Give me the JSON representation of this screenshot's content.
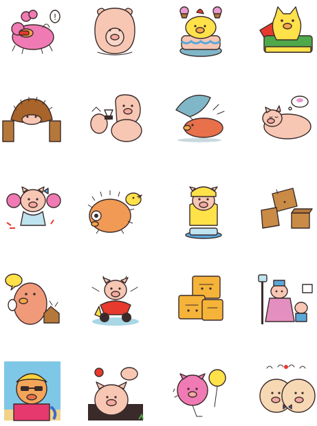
{
  "sheet": {
    "background": "#ffffff",
    "rows": 5,
    "cols": 4
  },
  "palette": {
    "pig_pink": "#f7c7b4",
    "hot_pink": "#f07ab4",
    "yellow": "#ffe14a",
    "brown": "#b5783a",
    "cardboard": "#c98b45",
    "teal": "#7fb7c8",
    "blue": "#5aa7d8",
    "red": "#e63a2e",
    "green": "#4fa84a",
    "orange": "#f5a64a",
    "outline": "#3a2a2a"
  },
  "stickers": [
    {
      "icon": "pink-pig-eating-icon",
      "bubble": "!"
    },
    {
      "icon": "pale-pig-sitting-icon"
    },
    {
      "icon": "pig-cake-icon"
    },
    {
      "icon": "yellow-cat-pig-icon"
    },
    {
      "icon": "hedgehog-pig-bridge-icon"
    },
    {
      "icon": "pig-onigiri-icon"
    },
    {
      "icon": "pig-umbrella-icon"
    },
    {
      "icon": "pig-sleeping-icon"
    },
    {
      "icon": "cheerleader-pig-icon"
    },
    {
      "icon": "pufferfish-pig-icon"
    },
    {
      "icon": "pig-scale-icon"
    },
    {
      "icon": "cardboard-boxes-icon"
    },
    {
      "icon": "pig-speech-icon"
    },
    {
      "icon": "pig-motorbike-icon"
    },
    {
      "icon": "stacked-pig-boxes-icon"
    },
    {
      "icon": "pig-family-bus-stop-icon"
    },
    {
      "icon": "sunglasses-pig-beach-icon"
    },
    {
      "icon": "pig-with-baby-icon"
    },
    {
      "icon": "pig-balloon-icon"
    },
    {
      "icon": "twin-pigs-icon"
    }
  ]
}
